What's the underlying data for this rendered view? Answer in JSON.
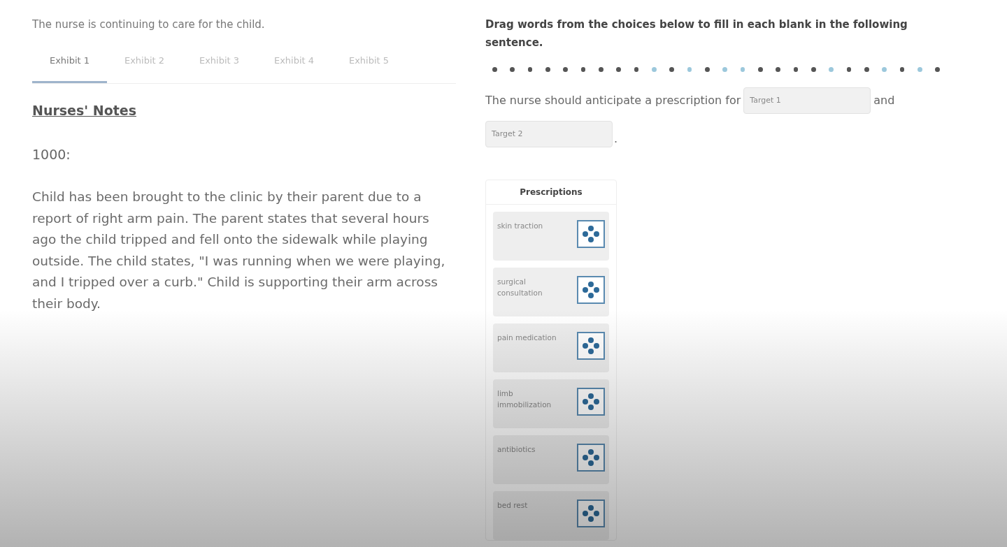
{
  "scenario": "The nurse is continuing to care for the child.",
  "tabs": [
    {
      "label": "Exhibit 1",
      "selected": true
    },
    {
      "label": "Exhibit 2",
      "selected": false
    },
    {
      "label": "Exhibit 3",
      "selected": false
    },
    {
      "label": "Exhibit 4",
      "selected": false
    },
    {
      "label": "Exhibit 5",
      "selected": false
    }
  ],
  "notes": {
    "heading": "Nurses' Notes",
    "time": "1000:",
    "body": "Child has been brought to the clinic by their parent due to a report of right arm pain. The parent states that several hours ago the child tripped and fell onto the sidewalk while playing outside. The child states, \"I was running when we were playing, and I tripped over a curb.\" Child is supporting their arm across their body."
  },
  "instruction": "Drag words from the choices below to fill in each blank in the following sentence.",
  "progress_dots": [
    {
      "color": "#555555"
    },
    {
      "color": "#555555"
    },
    {
      "color": "#555555"
    },
    {
      "color": "#555555"
    },
    {
      "color": "#555555"
    },
    {
      "color": "#555555"
    },
    {
      "color": "#555555"
    },
    {
      "color": "#555555"
    },
    {
      "color": "#555555"
    },
    {
      "color": "#9cc8dc"
    },
    {
      "color": "#555555"
    },
    {
      "color": "#9cc8dc"
    },
    {
      "color": "#555555"
    },
    {
      "color": "#9cc8dc"
    },
    {
      "color": "#9cc8dc"
    },
    {
      "color": "#555555"
    },
    {
      "color": "#555555"
    },
    {
      "color": "#555555"
    },
    {
      "color": "#555555"
    },
    {
      "color": "#9cc8dc"
    },
    {
      "color": "#555555"
    },
    {
      "color": "#555555"
    },
    {
      "color": "#9cc8dc"
    },
    {
      "color": "#555555"
    },
    {
      "color": "#9cc8dc"
    },
    {
      "color": "#555555"
    }
  ],
  "sentence": {
    "before": "The nurse should anticipate a prescription for",
    "target_1": "Target 1",
    "middle": "and",
    "target_2": "Target 2",
    "after": "."
  },
  "choices": {
    "title": "Prescriptions",
    "items": [
      "skin traction",
      "surgical consultation",
      "pain medication",
      "limb immobilization",
      "antibiotics",
      "bed rest"
    ]
  }
}
